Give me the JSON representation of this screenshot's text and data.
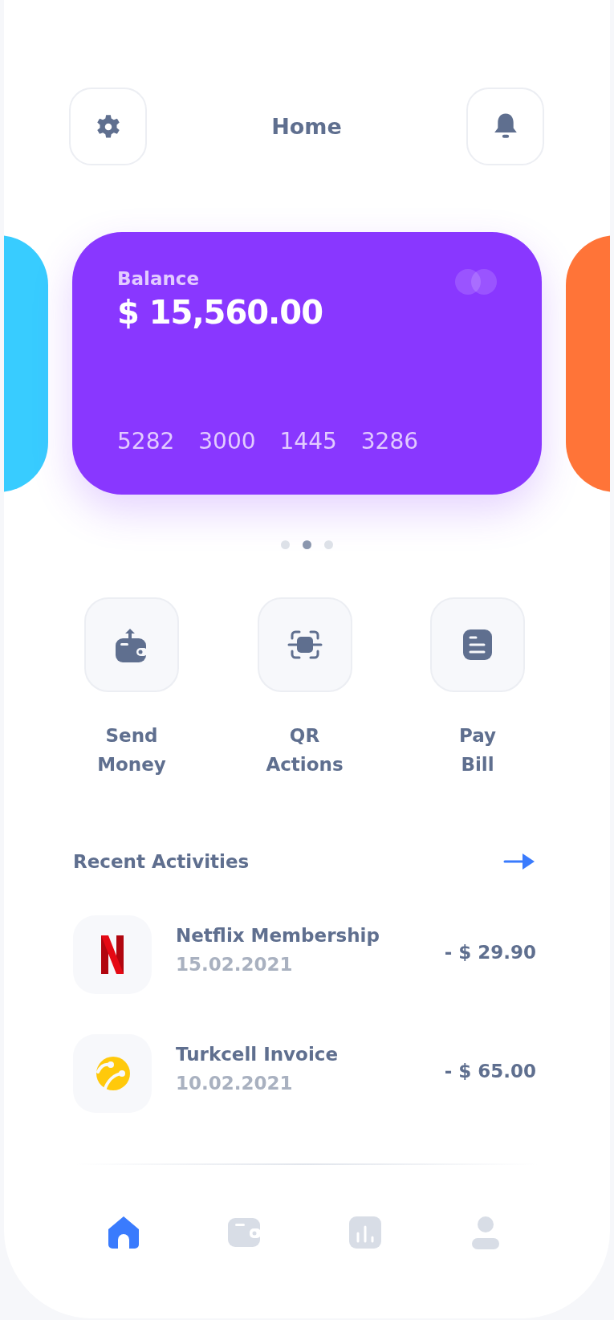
{
  "header": {
    "title": "Home"
  },
  "cards": [
    {
      "kind": "peek",
      "color": "#38ccff"
    },
    {
      "kind": "main",
      "color": "#8937ff",
      "label": "Balance",
      "amount": "$ 15,560.00",
      "number_groups": [
        "5282",
        "3000",
        "1445",
        "3286"
      ]
    },
    {
      "kind": "peek",
      "color": "#ff7438"
    }
  ],
  "pager": [
    {
      "selected": false
    },
    {
      "selected": true
    },
    {
      "selected": false
    }
  ],
  "actions": [
    {
      "kind": "send",
      "label": "Send Money"
    },
    {
      "kind": "qr",
      "label": "QR Actions"
    },
    {
      "kind": "bill",
      "label": "Pay Bill"
    }
  ],
  "recent": {
    "title": "Recent Activities",
    "items": [
      {
        "kind": "netflix",
        "name": "Netflix Membership",
        "date": "15.02.2021",
        "amount": "- $ 29.90"
      },
      {
        "kind": "turkcell",
        "name": "Turkcell Invoice",
        "date": "10.02.2021",
        "amount": "- $ 65.00"
      }
    ]
  },
  "nav": [
    {
      "kind": "home",
      "selected": true
    },
    {
      "kind": "wallet",
      "selected": false
    },
    {
      "kind": "stats",
      "selected": false
    },
    {
      "kind": "profile",
      "selected": false
    }
  ]
}
